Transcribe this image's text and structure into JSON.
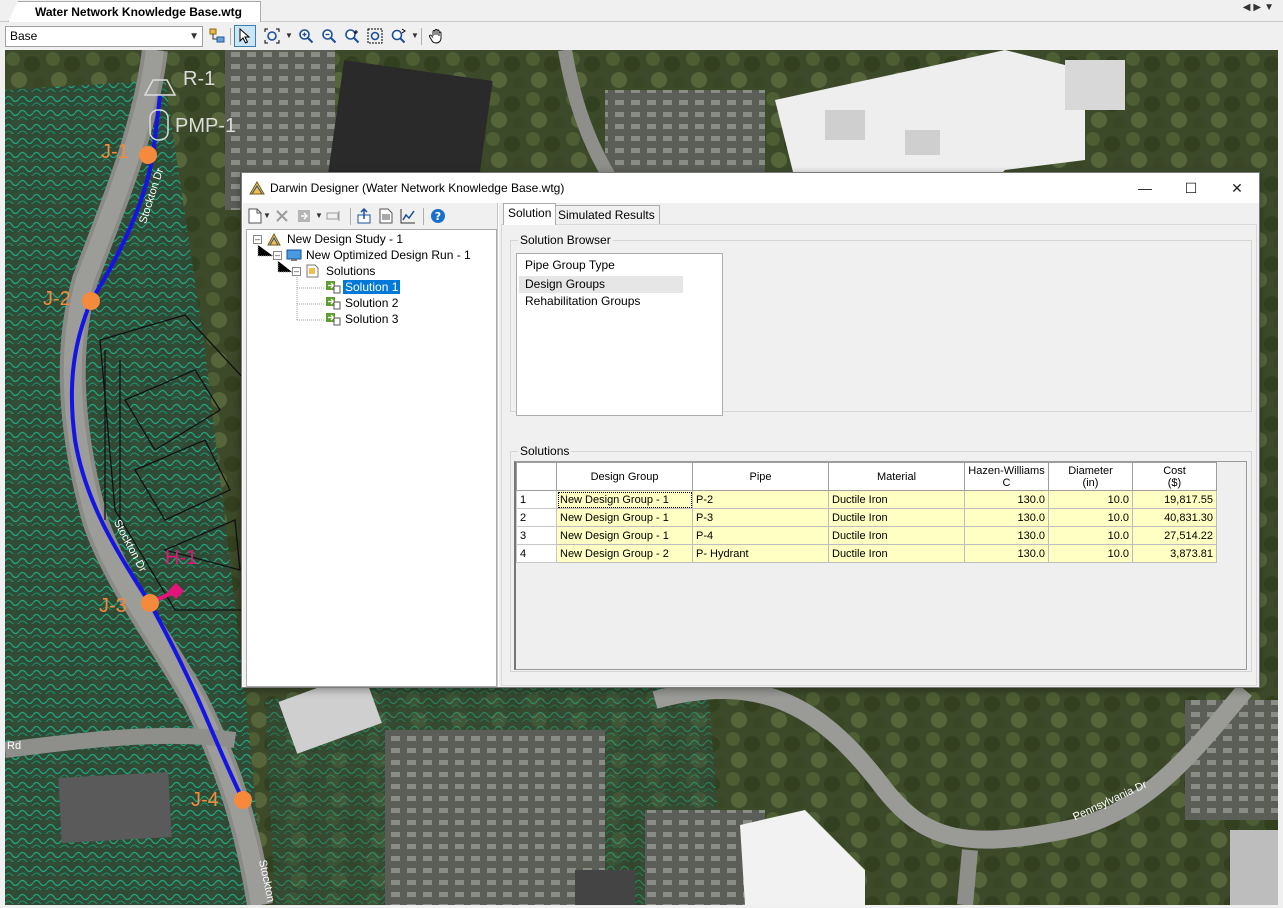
{
  "document": {
    "tab_title": "Water Network Knowledge Base.wtg"
  },
  "toolbar": {
    "scenario": "Base",
    "icons": [
      "scenario-tree-icon",
      "select-arrow-icon",
      "zoom-extents-icon",
      "zoom-in-icon",
      "zoom-out-icon",
      "zoom-realtime-icon",
      "zoom-window-icon",
      "zoom-previous-icon",
      "pan-hand-icon"
    ]
  },
  "map": {
    "labels": {
      "r1": "R-1",
      "pmp1": "PMP-1",
      "j1": "J-1",
      "j2": "J-2",
      "j3": "J-3",
      "j4": "J-4",
      "h1": "H-1",
      "road1": "Stockton Dr",
      "road2": "Stockton Dr",
      "road3": "Stockton",
      "road4": "Pennsylvania Dr",
      "road5": "Rd"
    },
    "colors": {
      "pipe": "#1414e6",
      "junction": "#f58a3c",
      "hydrant": "#e6147a",
      "contour": "#1fb08a"
    }
  },
  "dialog": {
    "title": "Darwin Designer (Water Network Knowledge Base.wtg)",
    "window_buttons": {
      "minimize": "—",
      "maximize": "☐",
      "close": "✕"
    },
    "tree": {
      "study": "New Design Study - 1",
      "run": "New Optimized Design Run - 1",
      "solutions_folder": "Solutions",
      "solutions": [
        "Solution 1",
        "Solution 2",
        "Solution 3"
      ],
      "selected": "Solution 1"
    },
    "tabs": [
      "Solution",
      "Simulated Results"
    ],
    "active_tab": "Solution",
    "solution_browser": {
      "title": "Solution Browser",
      "header": "Pipe Group Type",
      "items": [
        "Design Groups",
        "Rehabilitation Groups"
      ],
      "selected": "Design Groups"
    },
    "solutions_table": {
      "title": "Solutions",
      "columns": [
        {
          "line1": "",
          "line2": ""
        },
        {
          "line1": "Design Group",
          "line2": ""
        },
        {
          "line1": "Pipe",
          "line2": ""
        },
        {
          "line1": "Material",
          "line2": ""
        },
        {
          "line1": "Hazen-Williams",
          "line2": "C"
        },
        {
          "line1": "Diameter",
          "line2": "(in)"
        },
        {
          "line1": "Cost",
          "line2": "($)"
        }
      ],
      "rows": [
        {
          "id": "1",
          "design_group": "New Design Group - 1",
          "pipe": "P-2",
          "material": "Ductile Iron",
          "hw_c": "130.0",
          "diameter": "10.0",
          "cost": "19,817.55"
        },
        {
          "id": "2",
          "design_group": "New Design Group - 1",
          "pipe": "P-3",
          "material": "Ductile Iron",
          "hw_c": "130.0",
          "diameter": "10.0",
          "cost": "40,831.30"
        },
        {
          "id": "3",
          "design_group": "New Design Group - 1",
          "pipe": "P-4",
          "material": "Ductile Iron",
          "hw_c": "130.0",
          "diameter": "10.0",
          "cost": "27,514.22"
        },
        {
          "id": "4",
          "design_group": "New Design Group - 2",
          "pipe": "P- Hydrant",
          "material": "Ductile Iron",
          "hw_c": "130.0",
          "diameter": "10.0",
          "cost": "3,873.81"
        }
      ]
    }
  }
}
